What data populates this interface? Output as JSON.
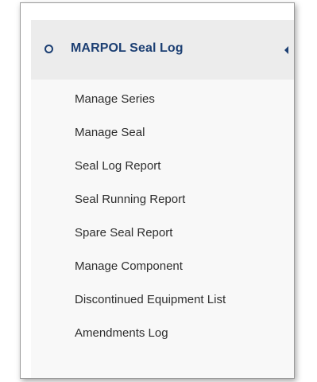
{
  "menu": {
    "title": "MARPOL Seal Log",
    "header_icon": "circle-outline-icon",
    "toggle_icon": "caret-left-icon",
    "accent_color": "#1c3f73",
    "items": [
      {
        "label": "Manage Series"
      },
      {
        "label": "Manage Seal"
      },
      {
        "label": "Seal Log Report"
      },
      {
        "label": "Seal Running Report"
      },
      {
        "label": "Spare Seal Report"
      },
      {
        "label": "Manage Component"
      },
      {
        "label": "Discontinued Equipment List"
      },
      {
        "label": "Amendments Log"
      }
    ]
  }
}
